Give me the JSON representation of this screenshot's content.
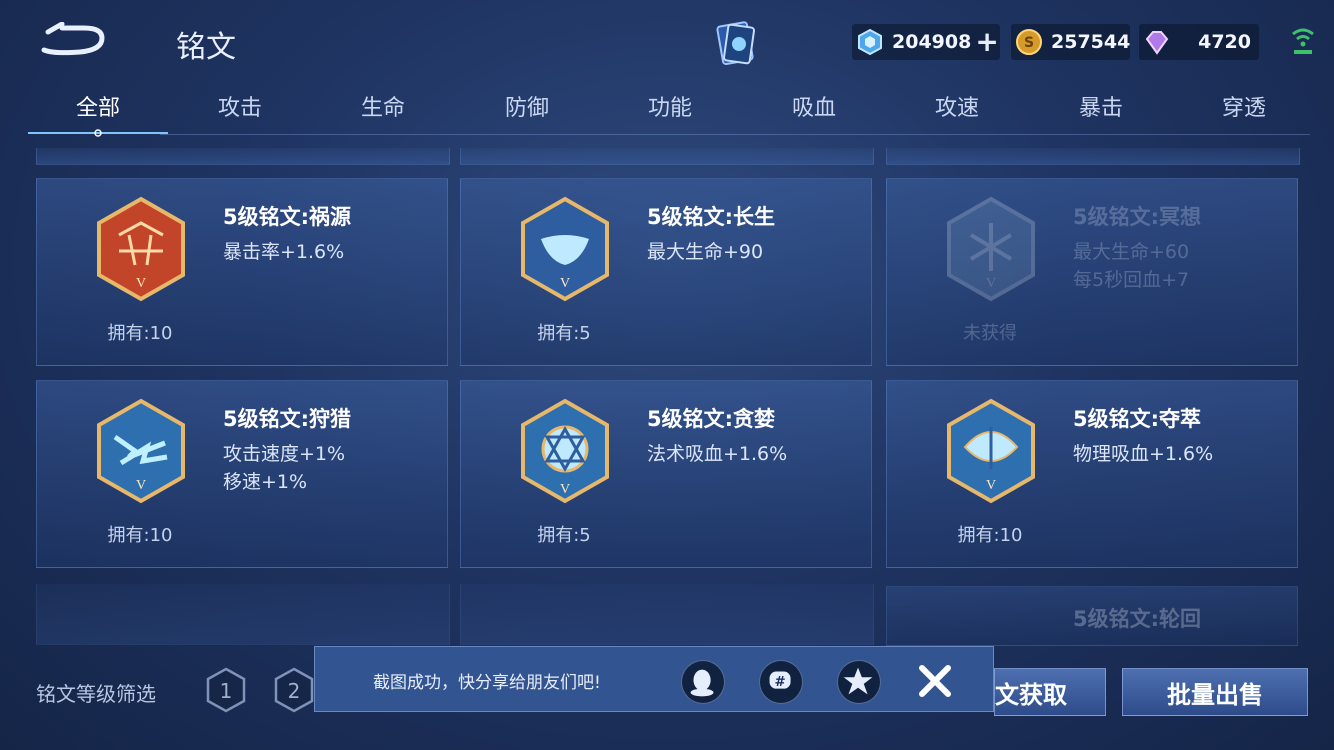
{
  "header": {
    "title": "铭文",
    "currencies": [
      {
        "icon": "diamond-coupon-icon",
        "value": "204908"
      },
      {
        "icon": "gold-coin-icon",
        "value": "257544"
      },
      {
        "icon": "purple-crystal-icon",
        "value": "4720"
      }
    ]
  },
  "tabs": [
    "全部",
    "攻击",
    "生命",
    "防御",
    "功能",
    "吸血",
    "攻速",
    "暴击",
    "穿透"
  ],
  "active_tab": "全部",
  "cards": [
    {
      "name": "5级铭文:祸源",
      "stats": [
        "暴击率+1.6%"
      ],
      "owned": "拥有:10",
      "color": "#c2452a"
    },
    {
      "name": "5级铭文:长生",
      "stats": [
        "最大生命+90"
      ],
      "owned": "拥有:5",
      "color": "#2e5ea0"
    },
    {
      "name": "5级铭文:冥想",
      "stats": [
        "最大生命+60",
        "每5秒回血+7"
      ],
      "owned": "未获得",
      "color": "#6c8fb8"
    },
    {
      "name": "5级铭文:狩猎",
      "stats": [
        "攻击速度+1%",
        "移速+1%"
      ],
      "owned": "拥有:10",
      "color": "#2e6fb0"
    },
    {
      "name": "5级铭文:贪婪",
      "stats": [
        "法术吸血+1.6%"
      ],
      "owned": "拥有:5",
      "color": "#2e6fb0"
    },
    {
      "name": "5级铭文:夺萃",
      "stats": [
        "物理吸血+1.6%"
      ],
      "owned": "拥有:10",
      "color": "#2e6fb0"
    }
  ],
  "peek_card": {
    "name": "5级铭文:轮回"
  },
  "bottom": {
    "filter_label": "铭文等级筛选",
    "levels": [
      "1",
      "2"
    ],
    "get_button": "文获取",
    "sell_button": "批量出售"
  },
  "toast": {
    "text": "截图成功，快分享给朋友们吧!",
    "share_icons": [
      "qq-icon",
      "wechat-moments-icon",
      "qzone-icon"
    ]
  }
}
